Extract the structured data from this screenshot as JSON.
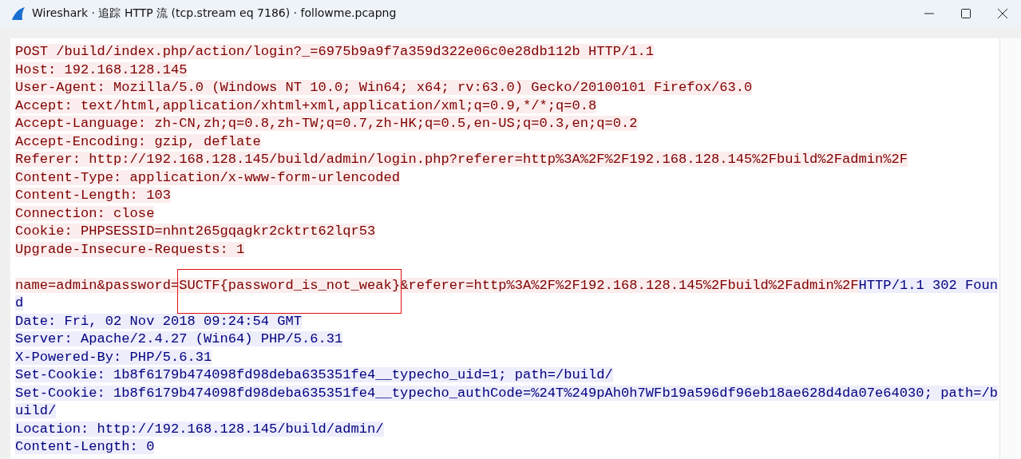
{
  "window": {
    "title": "Wireshark · 追踪 HTTP 流 (tcp.stream eq 7186) · followme.pcapng"
  },
  "lines": [
    {
      "kind": "text",
      "segments": [
        {
          "kind": "client",
          "text": "POST /build/index.php/action/login?_=6975b9a9f7a359d322e06c0e28db112b HTTP/1.1"
        }
      ]
    },
    {
      "kind": "text",
      "segments": [
        {
          "kind": "client",
          "text": "Host: 192.168.128.145"
        }
      ]
    },
    {
      "kind": "text",
      "segments": [
        {
          "kind": "client",
          "text": "User-Agent: Mozilla/5.0 (Windows NT 10.0; Win64; x64; rv:63.0) Gecko/20100101 Firefox/63.0"
        }
      ]
    },
    {
      "kind": "text",
      "segments": [
        {
          "kind": "client",
          "text": "Accept: text/html,application/xhtml+xml,application/xml;q=0.9,*/*;q=0.8"
        }
      ]
    },
    {
      "kind": "text",
      "segments": [
        {
          "kind": "client",
          "text": "Accept-Language: zh-CN,zh;q=0.8,zh-TW;q=0.7,zh-HK;q=0.5,en-US;q=0.3,en;q=0.2"
        }
      ]
    },
    {
      "kind": "text",
      "segments": [
        {
          "kind": "client",
          "text": "Accept-Encoding: gzip, deflate"
        }
      ]
    },
    {
      "kind": "text",
      "segments": [
        {
          "kind": "client",
          "text": "Referer: http://192.168.128.145/build/admin/login.php?referer=http%3A%2F%2F192.168.128.145%2Fbuild%2Fadmin%2F"
        }
      ]
    },
    {
      "kind": "text",
      "segments": [
        {
          "kind": "client",
          "text": "Content-Type: application/x-www-form-urlencoded"
        }
      ]
    },
    {
      "kind": "text",
      "segments": [
        {
          "kind": "client",
          "text": "Content-Length: 103"
        }
      ]
    },
    {
      "kind": "text",
      "segments": [
        {
          "kind": "client",
          "text": "Connection: close"
        }
      ]
    },
    {
      "kind": "text",
      "segments": [
        {
          "kind": "client",
          "text": "Cookie: PHPSESSID=nhnt265gqagkr2cktrt62lqr53"
        }
      ]
    },
    {
      "kind": "text",
      "segments": [
        {
          "kind": "client",
          "text": "Upgrade-Insecure-Requests: 1"
        }
      ]
    },
    {
      "kind": "blank"
    },
    {
      "kind": "text",
      "segments": [
        {
          "kind": "client",
          "text": "name=admin&password="
        },
        {
          "kind": "client",
          "text": "SUCTF{password_is_not_weak}",
          "marked": true
        },
        {
          "kind": "client",
          "text": "&referer=http%3A%2F%2F192.168.128.145%2Fbuild%2Fadmin%2F"
        },
        {
          "kind": "server",
          "text": "HTTP/1.1 302 Foun"
        }
      ]
    },
    {
      "kind": "text",
      "segments": [
        {
          "kind": "server",
          "text": "d"
        }
      ]
    },
    {
      "kind": "text",
      "segments": [
        {
          "kind": "server",
          "text": "Date: Fri, 02 Nov 2018 09:24:54 GMT"
        }
      ]
    },
    {
      "kind": "text",
      "segments": [
        {
          "kind": "server",
          "text": "Server: Apache/2.4.27 (Win64) PHP/5.6.31"
        }
      ]
    },
    {
      "kind": "text",
      "segments": [
        {
          "kind": "server",
          "text": "X-Powered-By: PHP/5.6.31"
        }
      ]
    },
    {
      "kind": "text",
      "segments": [
        {
          "kind": "server",
          "text": "Set-Cookie: 1b8f6179b474098fd98deba635351fe4__typecho_uid=1; path=/build/"
        }
      ]
    },
    {
      "kind": "text",
      "segments": [
        {
          "kind": "server",
          "text": "Set-Cookie: 1b8f6179b474098fd98deba635351fe4__typecho_authCode=%24T%249pAh0h7WFb19a596df96eb18ae628d4da07e64030; path=/b"
        }
      ]
    },
    {
      "kind": "text",
      "segments": [
        {
          "kind": "server",
          "text": "uild/"
        }
      ]
    },
    {
      "kind": "text",
      "segments": [
        {
          "kind": "server",
          "text": "Location: http://192.168.128.145/build/admin/"
        }
      ]
    },
    {
      "kind": "text",
      "segments": [
        {
          "kind": "server",
          "text": "Content-Length: 0"
        }
      ]
    }
  ]
}
